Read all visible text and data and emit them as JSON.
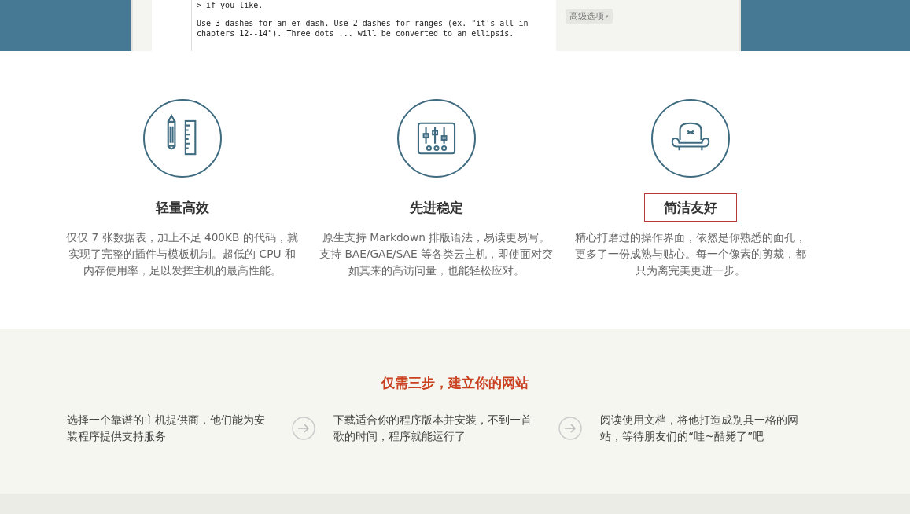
{
  "editor_preview": {
    "paragraphs": [
      [
        "> if you like."
      ],
      [
        "Use 3 dashes for an em-dash. Use 2 dashes for ranges (ex. \"it's all in",
        "chapters 12--14\"). Three dots ... will be converted to an ellipsis."
      ]
    ],
    "advanced_button": "高级选项",
    "advanced_caret": "▾"
  },
  "features": [
    {
      "title": "轻量高效",
      "highlighted": false,
      "description": "仅仅 7 张数据表，加上不足 400KB 的代码，就实现了完整的插件与模板机制。超低的 CPU 和内存使用率，足以发挥主机的最高性能。"
    },
    {
      "title": "先进稳定",
      "highlighted": false,
      "description": "原生支持 Markdown 排版语法，易读更易写。支持 BAE/GAE/SAE 等各类云主机，即使面对突如其来的高访问量，也能轻松应对。"
    },
    {
      "title": "简洁友好",
      "highlighted": true,
      "description": "精心打磨过的操作界面，依然是你熟悉的面孔，更多了一份成熟与贴心。每一个像素的剪裁，都只为离完美更进一步。"
    }
  ],
  "steps_section": {
    "title": "仅需三步，建立你的网站",
    "steps": [
      "选择一个靠谱的主机提供商，他们能为安装程序提供支持服务",
      "下载适合你的程序版本并安装，不到一首歌的时间，程序就能运行了",
      "阅读使用文档，将他打造成别具一格的网站，等待朋友们的“哇~酷毙了”吧"
    ]
  }
}
